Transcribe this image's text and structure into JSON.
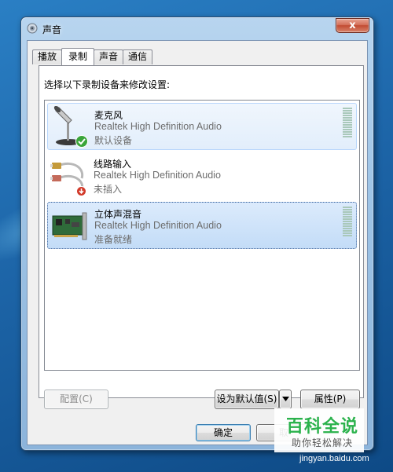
{
  "window": {
    "title": "声音",
    "close_glyph": "x"
  },
  "tabs": [
    {
      "label": "播放",
      "active": false
    },
    {
      "label": "录制",
      "active": true
    },
    {
      "label": "声音",
      "active": false
    },
    {
      "label": "通信",
      "active": false
    }
  ],
  "instruction": "选择以下录制设备来修改设置:",
  "devices": [
    {
      "name": "麦克风",
      "driver": "Realtek High Definition Audio",
      "status": "默认设备",
      "icon": "microphone-icon",
      "badge": "default-check-icon"
    },
    {
      "name": "线路输入",
      "driver": "Realtek High Definition Audio",
      "status": "未插入",
      "icon": "line-in-cable-icon",
      "badge": "unplugged-icon"
    },
    {
      "name": "立体声混音",
      "driver": "Realtek High Definition Audio",
      "status": "准备就绪",
      "icon": "sound-card-icon",
      "badge": ""
    }
  ],
  "buttons": {
    "configure": "配置(C)",
    "set_default": "设为默认值(S)",
    "properties": "属性(P)",
    "ok": "确定",
    "cancel": "取"
  },
  "watermark": {
    "title": "百科全说",
    "subtitle": "助你轻松解决",
    "url": "jingyan.baidu.com"
  },
  "colors": {
    "selection_light": "#e2eefb",
    "selection": "#c3dcf7",
    "watermark_green": "#2bb24c"
  }
}
